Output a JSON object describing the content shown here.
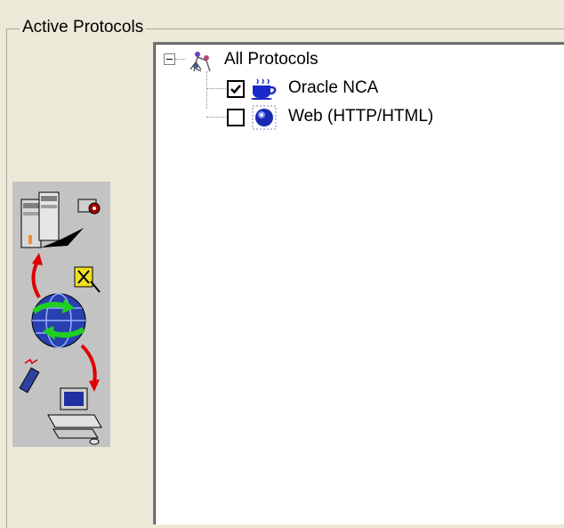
{
  "group": {
    "title": "Active Protocols"
  },
  "illustration": {
    "name": "network-protocols-illustration"
  },
  "tree": {
    "root": {
      "label": "All Protocols",
      "expanded": true
    },
    "items": [
      {
        "label": "Oracle NCA",
        "checked": true,
        "icon": "java-cup-icon"
      },
      {
        "label": "Web (HTTP/HTML)",
        "checked": false,
        "icon": "web-globe-icon"
      }
    ]
  }
}
